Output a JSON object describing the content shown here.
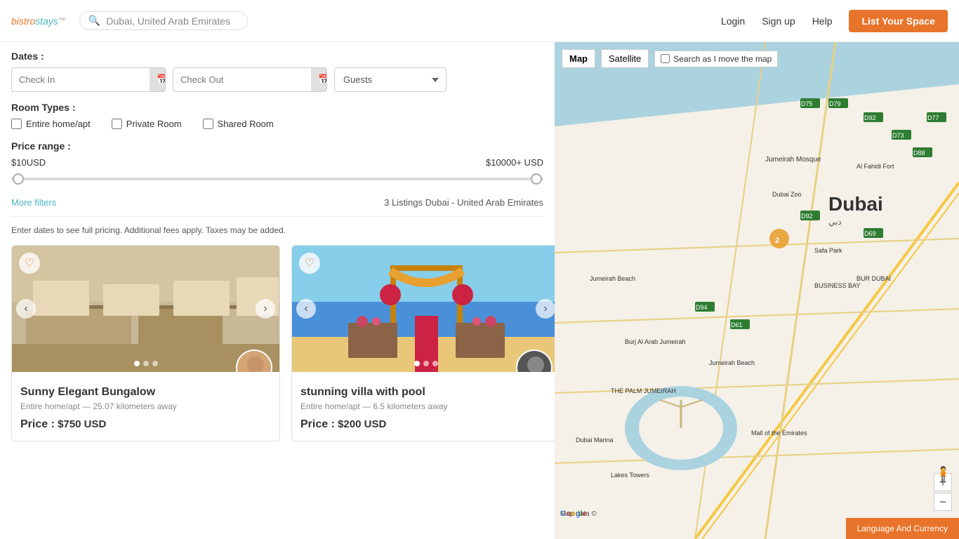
{
  "header": {
    "logo_bistro": "bistro",
    "logo_stays": "stays",
    "logo_tm": "™",
    "search_placeholder": "Dubai,  United Arab Emirates",
    "nav": {
      "login": "Login",
      "signup": "Sign up",
      "help": "Help",
      "list_space": "List Your Space"
    }
  },
  "filters": {
    "dates_label": "Dates :",
    "check_in_placeholder": "Check In",
    "check_out_placeholder": "Check Out",
    "room_types_label": "Room Types :",
    "room_types": [
      {
        "id": "entire",
        "label": "Entire home/apt",
        "checked": false
      },
      {
        "id": "private",
        "label": "Private Room",
        "checked": false
      },
      {
        "id": "shared",
        "label": "Shared Room",
        "checked": false
      }
    ],
    "price_range_label": "Price range :",
    "price_min": "$10USD",
    "price_max": "$10000+ USD",
    "more_filters": "More filters",
    "listings_count": "3 Listings Dubai - United Arab Emirates",
    "pricing_note": "Enter dates to see full pricing. Additional fees apply. Taxes may be added."
  },
  "listings": [
    {
      "id": 1,
      "title": "Sunny Elegant Bungalow",
      "subtitle": "Entire home/apt — 25.07 kilometers away",
      "price_label": "Price :",
      "price": "$750 USD",
      "dots": 3,
      "active_dot": 0
    },
    {
      "id": 2,
      "title": "stunning villa with pool",
      "subtitle": "Entire home/apt — 6.5 kilometers away",
      "price_label": "Price :",
      "price": "$200 USD",
      "dots": 3,
      "active_dot": 0
    }
  ],
  "map": {
    "map_btn": "Map",
    "satellite_btn": "Satellite",
    "search_move_label": "Search as I move the map",
    "language_currency": "Language And Currency",
    "zoom_in": "+",
    "zoom_out": "−"
  }
}
